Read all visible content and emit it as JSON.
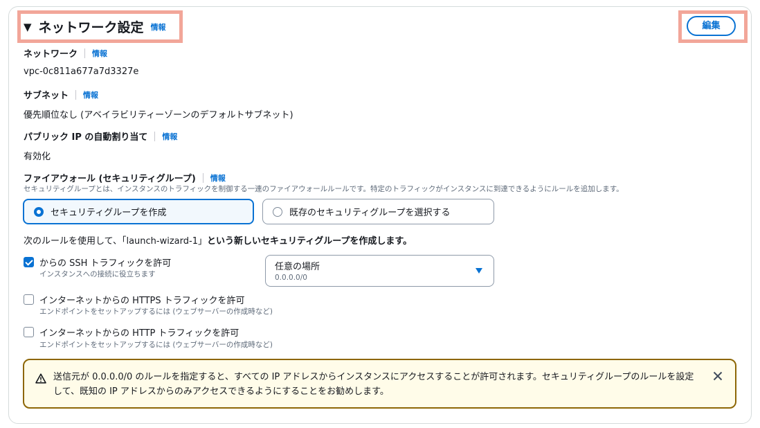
{
  "section": {
    "caret": "▼",
    "title": "ネットワーク設定",
    "info": "情報",
    "edit_label": "編集"
  },
  "fields": [
    {
      "label": "ネットワーク",
      "info": "情報",
      "value": "vpc-0c811a677a7d3327e"
    },
    {
      "label": "サブネット",
      "info": "情報",
      "value": "優先順位なし (アベイラビリティーゾーンのデフォルトサブネット)"
    },
    {
      "label": "パブリック IP の自動割り当て",
      "info": "情報",
      "value": "有効化"
    }
  ],
  "firewall": {
    "label": "ファイアウォール (セキュリティグループ)",
    "info": "情報",
    "description": "セキュリティグループとは、インスタンスのトラフィックを制御する一連のファイアウォールルールです。特定のトラフィックがインスタンスに到達できるようにルールを追加します。",
    "options": [
      {
        "label": "セキュリティグループを作成",
        "selected": true
      },
      {
        "label": "既存のセキュリティグループを選択する",
        "selected": false
      }
    ],
    "rule_heading_prefix": "次のルールを使用して、「launch-wizard-1」",
    "rule_heading_bold": "という新しいセキュリティグループを作成します。"
  },
  "rules": [
    {
      "label": "からの SSH トラフィックを許可",
      "sub": "インスタンスへの接続に役立ちます",
      "checked": true
    },
    {
      "label": "インターネットからの HTTPS トラフィックを許可",
      "sub": "エンドポイントをセットアップするには (ウェブサーバーの作成時など)",
      "checked": false
    },
    {
      "label": "インターネットからの HTTP トラフィックを許可",
      "sub": "エンドポイントをセットアップするには (ウェブサーバーの作成時など)",
      "checked": false
    }
  ],
  "ssh_source": {
    "selected": "任意の場所",
    "sub": "0.0.0.0/0"
  },
  "alert": {
    "message": "送信元が 0.0.0.0/0 のルールを指定すると、すべての IP アドレスからインスタンスにアクセスすることが許可されます。セキュリティグループのルールを設定して、既知の IP アドレスからのみアクセスできるようにすることをお勧めします。"
  },
  "colors": {
    "accent": "#0972d3",
    "highlight": "#f2a699",
    "warning_border": "#8d6605",
    "warning_bg": "#fffce9"
  }
}
